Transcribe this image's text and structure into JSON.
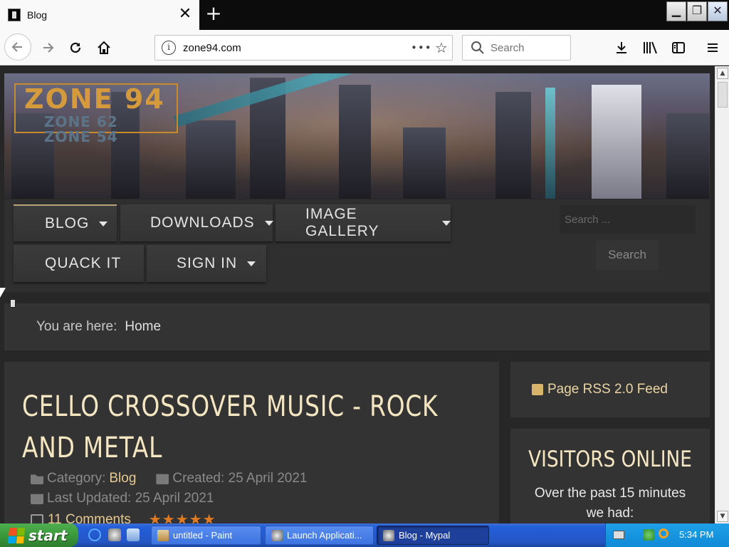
{
  "browser": {
    "tab": {
      "title": "Blog",
      "close_glyph": "✕"
    },
    "new_tab_glyph": "+",
    "url": "zone94.com",
    "search_placeholder": "Search",
    "url_more": "•••",
    "bookmark_glyph": "☆"
  },
  "site": {
    "logo": {
      "main": "ZONE 94",
      "sub1": "ZONE 62",
      "sub2": "ZONE 54"
    },
    "menu": {
      "blog": "BLOG",
      "downloads": "DOWNLOADS",
      "gallery": "IMAGE GALLERY",
      "quack": "QUACK IT",
      "signin": "SIGN IN"
    },
    "search_placeholder": "Search ...",
    "search_button": "Search",
    "breadcrumb": {
      "label": "You are here:",
      "home": "Home"
    },
    "article": {
      "title": "CELLO CROSSOVER MUSIC - ROCK AND METAL",
      "category_label": "Category:",
      "category": "Blog",
      "created": "Created: 25 April 2021",
      "updated": "Last Updated: 25 April 2021",
      "comments": "11 Comments",
      "stars_glyphs": "★★★★★",
      "rating": 5
    },
    "sidebar": {
      "rss": "Page RSS 2.0 Feed",
      "visitors_title": "VISITORS ONLINE",
      "visitors_text": "Over the past 15 minutes we had:"
    }
  },
  "taskbar": {
    "start": "start",
    "windows": [
      {
        "label": "untitled - Paint"
      },
      {
        "label": "Launch Applicati..."
      },
      {
        "label": "Blog - Mypal"
      }
    ],
    "clock": "5:34 PM"
  },
  "colors": {
    "page_bg": "#272727",
    "panel_bg": "#333333",
    "accent_gold": "#e6c891",
    "title_cream": "#f5e6c2",
    "star_orange": "#e07a22",
    "taskbar_blue": "#245edb"
  }
}
